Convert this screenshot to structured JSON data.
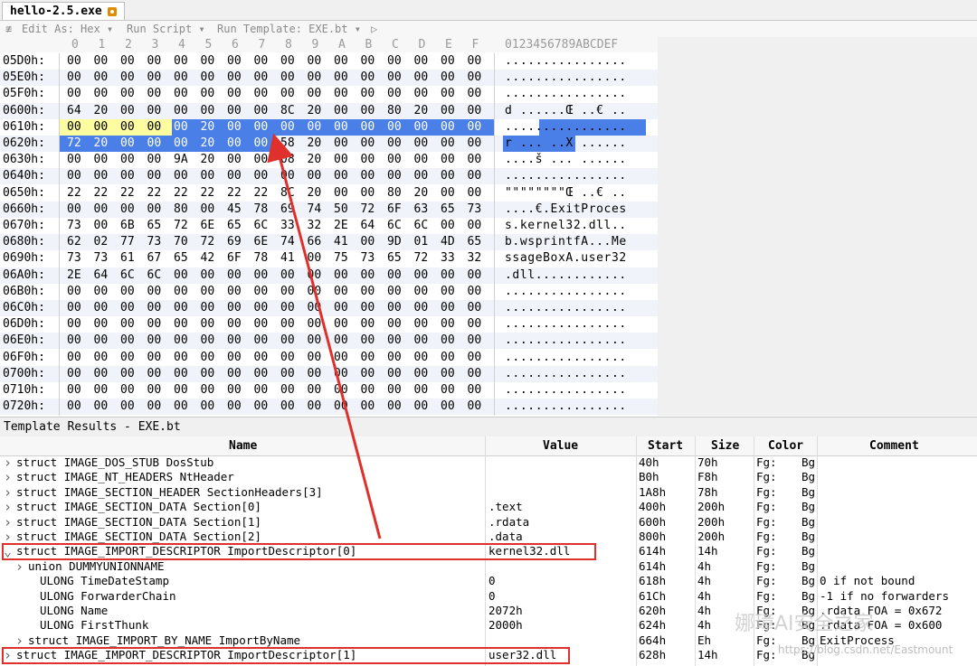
{
  "window": {
    "file_tab": "hello-2.5.exe"
  },
  "toolbar": {
    "pin": "≢",
    "edit_as": "Edit As: Hex ▾",
    "run_script": "Run Script ▾",
    "run_template": "Run Template: EXE.bt ▾",
    "play": "▷"
  },
  "columns": [
    "0",
    "1",
    "2",
    "3",
    "4",
    "5",
    "6",
    "7",
    "8",
    "9",
    "A",
    "B",
    "C",
    "D",
    "E",
    "F"
  ],
  "ascii_header": "0123456789ABCDEF",
  "hex_rows": [
    {
      "addr": "05D0h:",
      "bytes": [
        "00",
        "00",
        "00",
        "00",
        "00",
        "00",
        "00",
        "00",
        "00",
        "00",
        "00",
        "00",
        "00",
        "00",
        "00",
        "00"
      ],
      "ascii": "................"
    },
    {
      "addr": "05E0h:",
      "bytes": [
        "00",
        "00",
        "00",
        "00",
        "00",
        "00",
        "00",
        "00",
        "00",
        "00",
        "00",
        "00",
        "00",
        "00",
        "00",
        "00"
      ],
      "ascii": "................"
    },
    {
      "addr": "05F0h:",
      "bytes": [
        "00",
        "00",
        "00",
        "00",
        "00",
        "00",
        "00",
        "00",
        "00",
        "00",
        "00",
        "00",
        "00",
        "00",
        "00",
        "00"
      ],
      "ascii": "................"
    },
    {
      "addr": "0600h:",
      "bytes": [
        "64",
        "20",
        "00",
        "00",
        "00",
        "00",
        "00",
        "00",
        "8C",
        "20",
        "00",
        "00",
        "80",
        "20",
        "00",
        "00"
      ],
      "ascii": "d ......Œ ..€ .."
    },
    {
      "addr": "0610h:",
      "bytes": [
        "00",
        "00",
        "00",
        "00",
        "00",
        "20",
        "00",
        "00",
        "00",
        "00",
        "00",
        "00",
        "00",
        "00",
        "00",
        "00"
      ],
      "ascii": "................"
    },
    {
      "addr": "0620h:",
      "bytes": [
        "72",
        "20",
        "00",
        "00",
        "00",
        "20",
        "00",
        "00",
        "58",
        "20",
        "00",
        "00",
        "00",
        "00",
        "00",
        "00"
      ],
      "ascii": "r ... ..X ......"
    },
    {
      "addr": "0630h:",
      "bytes": [
        "00",
        "00",
        "00",
        "00",
        "9A",
        "20",
        "00",
        "00",
        "08",
        "20",
        "00",
        "00",
        "00",
        "00",
        "00",
        "00"
      ],
      "ascii": "....š ... ......"
    },
    {
      "addr": "0640h:",
      "bytes": [
        "00",
        "00",
        "00",
        "00",
        "00",
        "00",
        "00",
        "00",
        "00",
        "00",
        "00",
        "00",
        "00",
        "00",
        "00",
        "00"
      ],
      "ascii": "................"
    },
    {
      "addr": "0650h:",
      "bytes": [
        "22",
        "22",
        "22",
        "22",
        "22",
        "22",
        "22",
        "22",
        "8C",
        "20",
        "00",
        "00",
        "80",
        "20",
        "00",
        "00"
      ],
      "ascii": "\"\"\"\"\"\"\"\"Œ ..€ .."
    },
    {
      "addr": "0660h:",
      "bytes": [
        "00",
        "00",
        "00",
        "00",
        "80",
        "00",
        "45",
        "78",
        "69",
        "74",
        "50",
        "72",
        "6F",
        "63",
        "65",
        "73"
      ],
      "ascii": "....€.ExitProces"
    },
    {
      "addr": "0670h:",
      "bytes": [
        "73",
        "00",
        "6B",
        "65",
        "72",
        "6E",
        "65",
        "6C",
        "33",
        "32",
        "2E",
        "64",
        "6C",
        "6C",
        "00",
        "00"
      ],
      "ascii": "s.kernel32.dll.."
    },
    {
      "addr": "0680h:",
      "bytes": [
        "62",
        "02",
        "77",
        "73",
        "70",
        "72",
        "69",
        "6E",
        "74",
        "66",
        "41",
        "00",
        "9D",
        "01",
        "4D",
        "65"
      ],
      "ascii": "b.wsprintfA...Me"
    },
    {
      "addr": "0690h:",
      "bytes": [
        "73",
        "73",
        "61",
        "67",
        "65",
        "42",
        "6F",
        "78",
        "41",
        "00",
        "75",
        "73",
        "65",
        "72",
        "33",
        "32"
      ],
      "ascii": "ssageBoxA.user32"
    },
    {
      "addr": "06A0h:",
      "bytes": [
        "2E",
        "64",
        "6C",
        "6C",
        "00",
        "00",
        "00",
        "00",
        "00",
        "00",
        "00",
        "00",
        "00",
        "00",
        "00",
        "00"
      ],
      "ascii": ".dll............"
    },
    {
      "addr": "06B0h:",
      "bytes": [
        "00",
        "00",
        "00",
        "00",
        "00",
        "00",
        "00",
        "00",
        "00",
        "00",
        "00",
        "00",
        "00",
        "00",
        "00",
        "00"
      ],
      "ascii": "................"
    },
    {
      "addr": "06C0h:",
      "bytes": [
        "00",
        "00",
        "00",
        "00",
        "00",
        "00",
        "00",
        "00",
        "00",
        "00",
        "00",
        "00",
        "00",
        "00",
        "00",
        "00"
      ],
      "ascii": "................"
    },
    {
      "addr": "06D0h:",
      "bytes": [
        "00",
        "00",
        "00",
        "00",
        "00",
        "00",
        "00",
        "00",
        "00",
        "00",
        "00",
        "00",
        "00",
        "00",
        "00",
        "00"
      ],
      "ascii": "................"
    },
    {
      "addr": "06E0h:",
      "bytes": [
        "00",
        "00",
        "00",
        "00",
        "00",
        "00",
        "00",
        "00",
        "00",
        "00",
        "00",
        "00",
        "00",
        "00",
        "00",
        "00"
      ],
      "ascii": "................"
    },
    {
      "addr": "06F0h:",
      "bytes": [
        "00",
        "00",
        "00",
        "00",
        "00",
        "00",
        "00",
        "00",
        "00",
        "00",
        "00",
        "00",
        "00",
        "00",
        "00",
        "00"
      ],
      "ascii": "................"
    },
    {
      "addr": "0700h:",
      "bytes": [
        "00",
        "00",
        "00",
        "00",
        "00",
        "00",
        "00",
        "00",
        "00",
        "00",
        "00",
        "00",
        "00",
        "00",
        "00",
        "00"
      ],
      "ascii": "................"
    },
    {
      "addr": "0710h:",
      "bytes": [
        "00",
        "00",
        "00",
        "00",
        "00",
        "00",
        "00",
        "00",
        "00",
        "00",
        "00",
        "00",
        "00",
        "00",
        "00",
        "00"
      ],
      "ascii": "................"
    },
    {
      "addr": "0720h:",
      "bytes": [
        "00",
        "00",
        "00",
        "00",
        "00",
        "00",
        "00",
        "00",
        "00",
        "00",
        "00",
        "00",
        "00",
        "00",
        "00",
        "00"
      ],
      "ascii": "................"
    }
  ],
  "selection": {
    "start": "0614h",
    "length": "14h"
  },
  "template": {
    "title": "Template Results - EXE.bt",
    "headers": {
      "name": "Name",
      "value": "Value",
      "start": "Start",
      "size": "Size",
      "color": "Color",
      "comment": "Comment"
    },
    "rows": [
      {
        "exp": ">",
        "name": "struct IMAGE_DOS_STUB DosStub",
        "value": "",
        "start": "40h",
        "size": "70h",
        "fg": "Fg:",
        "bg": "Bg",
        "comment": ""
      },
      {
        "exp": ">",
        "name": "struct IMAGE_NT_HEADERS NtHeader",
        "value": "",
        "start": "B0h",
        "size": "F8h",
        "fg": "Fg:",
        "bg": "Bg",
        "comment": ""
      },
      {
        "exp": ">",
        "name": "struct IMAGE_SECTION_HEADER SectionHeaders[3]",
        "value": "",
        "start": "1A8h",
        "size": "78h",
        "fg": "Fg:",
        "bg": "Bg",
        "comment": ""
      },
      {
        "exp": ">",
        "name": "struct IMAGE_SECTION_DATA Section[0]",
        "value": ".text",
        "start": "400h",
        "size": "200h",
        "fg": "Fg:",
        "bg": "Bg",
        "comment": ""
      },
      {
        "exp": ">",
        "name": "struct IMAGE_SECTION_DATA Section[1]",
        "value": ".rdata",
        "start": "600h",
        "size": "200h",
        "fg": "Fg:",
        "bg": "Bg",
        "comment": ""
      },
      {
        "exp": ">",
        "name": "struct IMAGE_SECTION_DATA Section[2]",
        "value": ".data",
        "start": "800h",
        "size": "200h",
        "fg": "Fg:",
        "bg": "Bg",
        "comment": ""
      },
      {
        "exp": "v",
        "name": "struct IMAGE_IMPORT_DESCRIPTOR ImportDescriptor[0]",
        "value": "kernel32.dll",
        "start": "614h",
        "size": "14h",
        "fg": "Fg:",
        "bg": "Bg",
        "comment": ""
      },
      {
        "exp": ">",
        "indent": 1,
        "name": "union DUMMYUNIONNAME",
        "value": "",
        "start": "614h",
        "size": "4h",
        "fg": "Fg:",
        "bg": "Bg",
        "comment": ""
      },
      {
        "exp": "",
        "indent": 2,
        "name": "ULONG TimeDateStamp",
        "value": "0",
        "start": "618h",
        "size": "4h",
        "fg": "Fg:",
        "bg": "Bg",
        "comment": "0 if not bound"
      },
      {
        "exp": "",
        "indent": 2,
        "name": "ULONG ForwarderChain",
        "value": "0",
        "start": "61Ch",
        "size": "4h",
        "fg": "Fg:",
        "bg": "Bg",
        "comment": "-1 if no forwarders"
      },
      {
        "exp": "",
        "indent": 2,
        "name": "ULONG Name",
        "value": "2072h",
        "start": "620h",
        "size": "4h",
        "fg": "Fg:",
        "bg": "Bg",
        "comment": ".rdata FOA = 0x672"
      },
      {
        "exp": "",
        "indent": 2,
        "name": "ULONG FirstThunk",
        "value": "2000h",
        "start": "624h",
        "size": "4h",
        "fg": "Fg:",
        "bg": "Bg",
        "comment": ".rdata FOA = 0x600"
      },
      {
        "exp": ">",
        "indent": 1,
        "name": "struct IMAGE_IMPORT_BY_NAME ImportByName",
        "value": "",
        "start": "664h",
        "size": "Eh",
        "fg": "Fg:",
        "bg": "Bg",
        "comment": "ExitProcess"
      },
      {
        "exp": ">",
        "name": "struct IMAGE_IMPORT_DESCRIPTOR ImportDescriptor[1]",
        "value": "user32.dll",
        "start": "628h",
        "size": "14h",
        "fg": "Fg:",
        "bg": "Bg",
        "comment": ""
      }
    ]
  },
  "watermark": {
    "main": "娜璋AI安全之家",
    "url": "https://blog.csdn.net/Eastmount"
  },
  "colors": {
    "selection_blue": "#4a7fe8",
    "selection_yellow": "#fdfca0",
    "annotation_red": "#e0302c"
  }
}
